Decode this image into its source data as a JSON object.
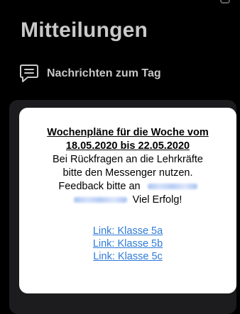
{
  "header": {
    "title": "Mitteilungen"
  },
  "section": {
    "icon": "chat-bubble-icon",
    "title": "Nachrichten zum Tag"
  },
  "message": {
    "heading_line1": "Wochenpläne für die Woche vom",
    "heading_line2": "18.05.2020 bis 22.05.2020",
    "body_line1": "Bei Rückfragen an die Lehrkräfte",
    "body_line2": "bitte den Messenger nutzen.",
    "body_line3": "Feedback bitte an",
    "body_line4": "Viel Erfolg!",
    "links": [
      "Link: Klasse 5a",
      "Link: Klasse 5b",
      "Link: Klasse 5c"
    ]
  },
  "colors": {
    "background": "#000000",
    "card_dark": "#1c1c1e",
    "card_light": "#ffffff",
    "link": "#2f7bd8",
    "header_text": "#c9c9c9"
  }
}
